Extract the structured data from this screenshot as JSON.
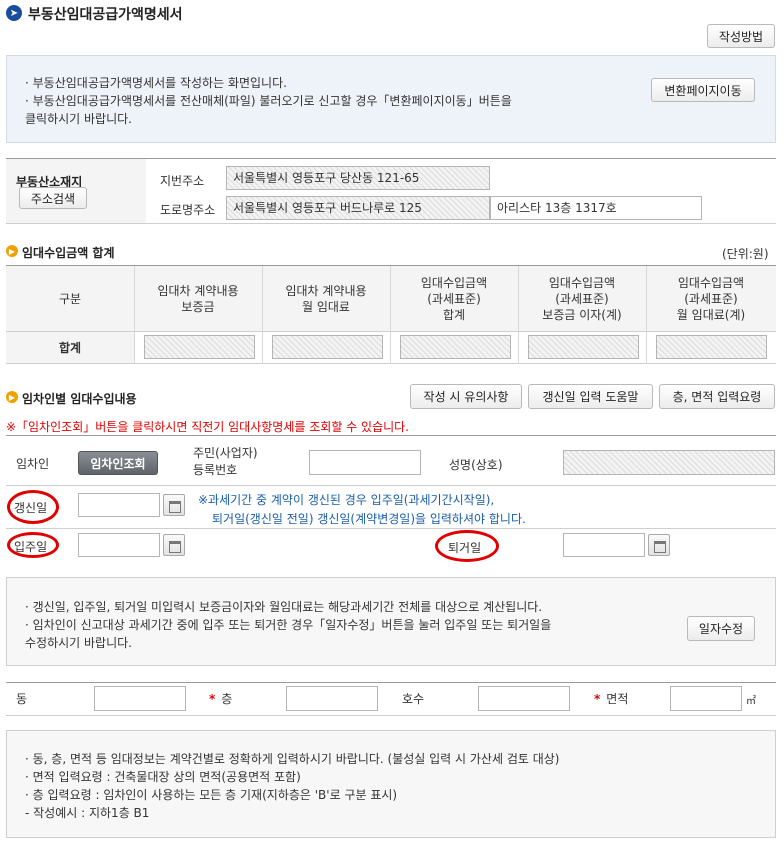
{
  "page": {
    "title": "부동산임대공급가액명세서",
    "guide_button": "작성방법"
  },
  "info1": {
    "lines": [
      "· 부동산임대공급가액명세서를 작성하는 화면입니다.",
      "· 부동산임대공급가액명세서를 전산매체(파일) 불러오기로 신고할 경우「변환페이지이동」버튼을",
      "  클릭하시기 바랍니다."
    ],
    "convert_button": "변환페이지이동"
  },
  "address": {
    "label": "부동산소재지",
    "search_button": "주소검색",
    "jibun_label": "지번주소",
    "jibun_value": "서울특별시 영등포구 당산동 121-65",
    "road_label": "도로명주소",
    "road_value": "서울특별시 영등포구 버드나루로 125",
    "detail_value": "아리스타 13층 1317호"
  },
  "totals": {
    "section_title": "임대수입금액 합계",
    "unit": "(단위:원)",
    "headers": [
      "구분",
      "임대차 계약내용\n보증금",
      "임대차 계약내용\n월 임대료",
      "임대수입금액\n(과세표준)\n합계",
      "임대수입금액\n(과세표준)\n보증금 이자(계)",
      "임대수입금액\n(과세표준)\n월 임대료(계)"
    ],
    "row_label": "합계"
  },
  "tenant": {
    "section_title": "임차인별 임대수입내용",
    "buttons": [
      "작성 시 유의사항",
      "갱신일 입력 도움말",
      "층, 면적 입력요령"
    ],
    "notice": "※「임차인조회」버튼을 클릭하시면 직전기 임대사항명세를 조회할 수 있습니다.",
    "tenant_label": "임차인",
    "lookup_button": "임차인조회",
    "rrn_label_1": "주민(사업자)",
    "rrn_label_2": "등록번호",
    "name_label": "성명(상호)",
    "renewal_label": "갱신일",
    "renewal_note_1": "※과세기간 중 계약이 갱신된 경우 입주일(과세기간시작일),",
    "renewal_note_2": "퇴거일(갱신일 전일) 갱신일(계약변경일)을 입력하셔야 합니다.",
    "movein_label": "입주일",
    "moveout_label": "퇴거일"
  },
  "info2": {
    "lines": [
      "· 갱신일, 입주일, 퇴거일 미입력시 보증금이자와 월임대료는 해당과세기간 전체를 대상으로 계산됩니다.",
      "· 임차인이 신고대상 과세기간 중에 입주 또는 퇴거한 경우「일자수정」버튼을 눌러 입주일 또는 퇴거일을",
      "  수정하시기 바랍니다."
    ],
    "edit_button": "일자수정"
  },
  "unit_row": {
    "dong_label": "동",
    "floor_star": "*",
    "floor_label": "층",
    "ho_label": "호수",
    "area_star": "*",
    "area_label": "면적",
    "area_unit": "㎡"
  },
  "info3": {
    "lines": [
      "· 동, 층, 면적 등 임대정보는 계약건별로  정확하게 입력하시기 바랍니다. (불성실 입력 시 가산세 검토 대상)",
      "· 면적 입력요령 : 건축물대장 상의 면적(공용면적 포함)",
      "· 층 입력요령 : 임차인이 사용하는 모든 층 기재(지하층은 'B'로 구분 표시)",
      "  - 작성예시 : 지하1층 B1"
    ]
  },
  "colors": {
    "title_icon": "#1a4e9c",
    "section_icon": "#f0a100",
    "notice_red": "#e00000",
    "note_blue": "#1a5ea8"
  }
}
